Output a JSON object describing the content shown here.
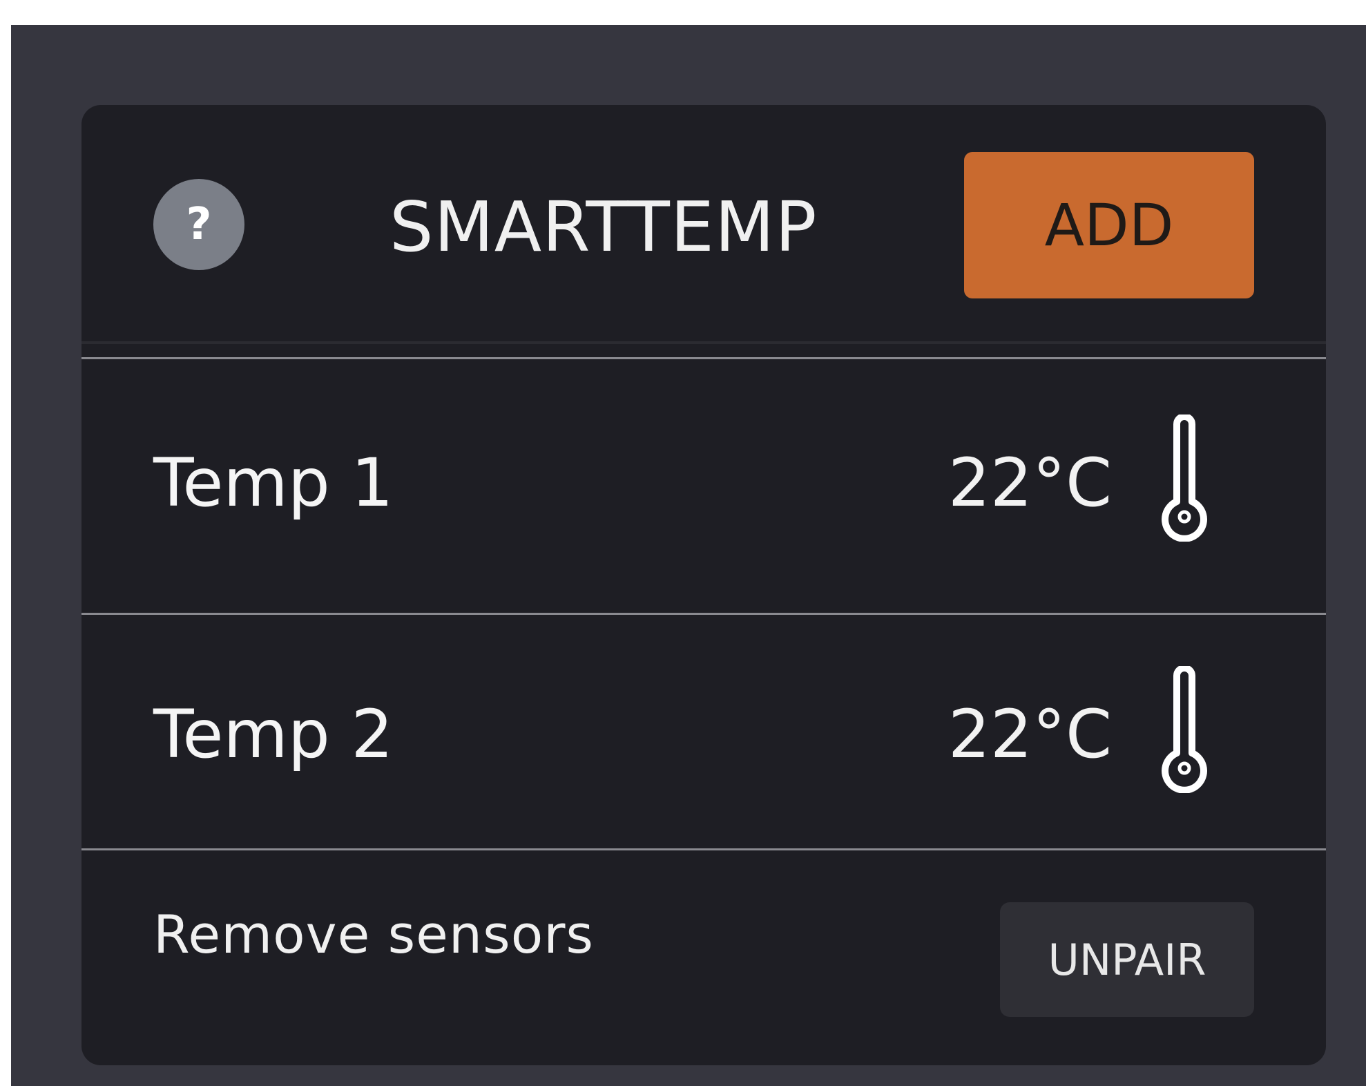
{
  "header": {
    "help_icon": "question-mark",
    "title": "SMARTTEMP",
    "add_label": "ADD"
  },
  "sensors": [
    {
      "label": "Temp 1",
      "value": "22°C",
      "icon": "thermometer-icon"
    },
    {
      "label": "Temp 2",
      "value": "22°C",
      "icon": "thermometer-icon"
    }
  ],
  "footer": {
    "remove_label": "Remove sensors",
    "unpair_label": "UNPAIR"
  },
  "colors": {
    "accent": "#c96a2f",
    "card_bg": "#1e1e24",
    "outer_bg": "#36363f",
    "help_icon_bg": "#7b7f88"
  }
}
